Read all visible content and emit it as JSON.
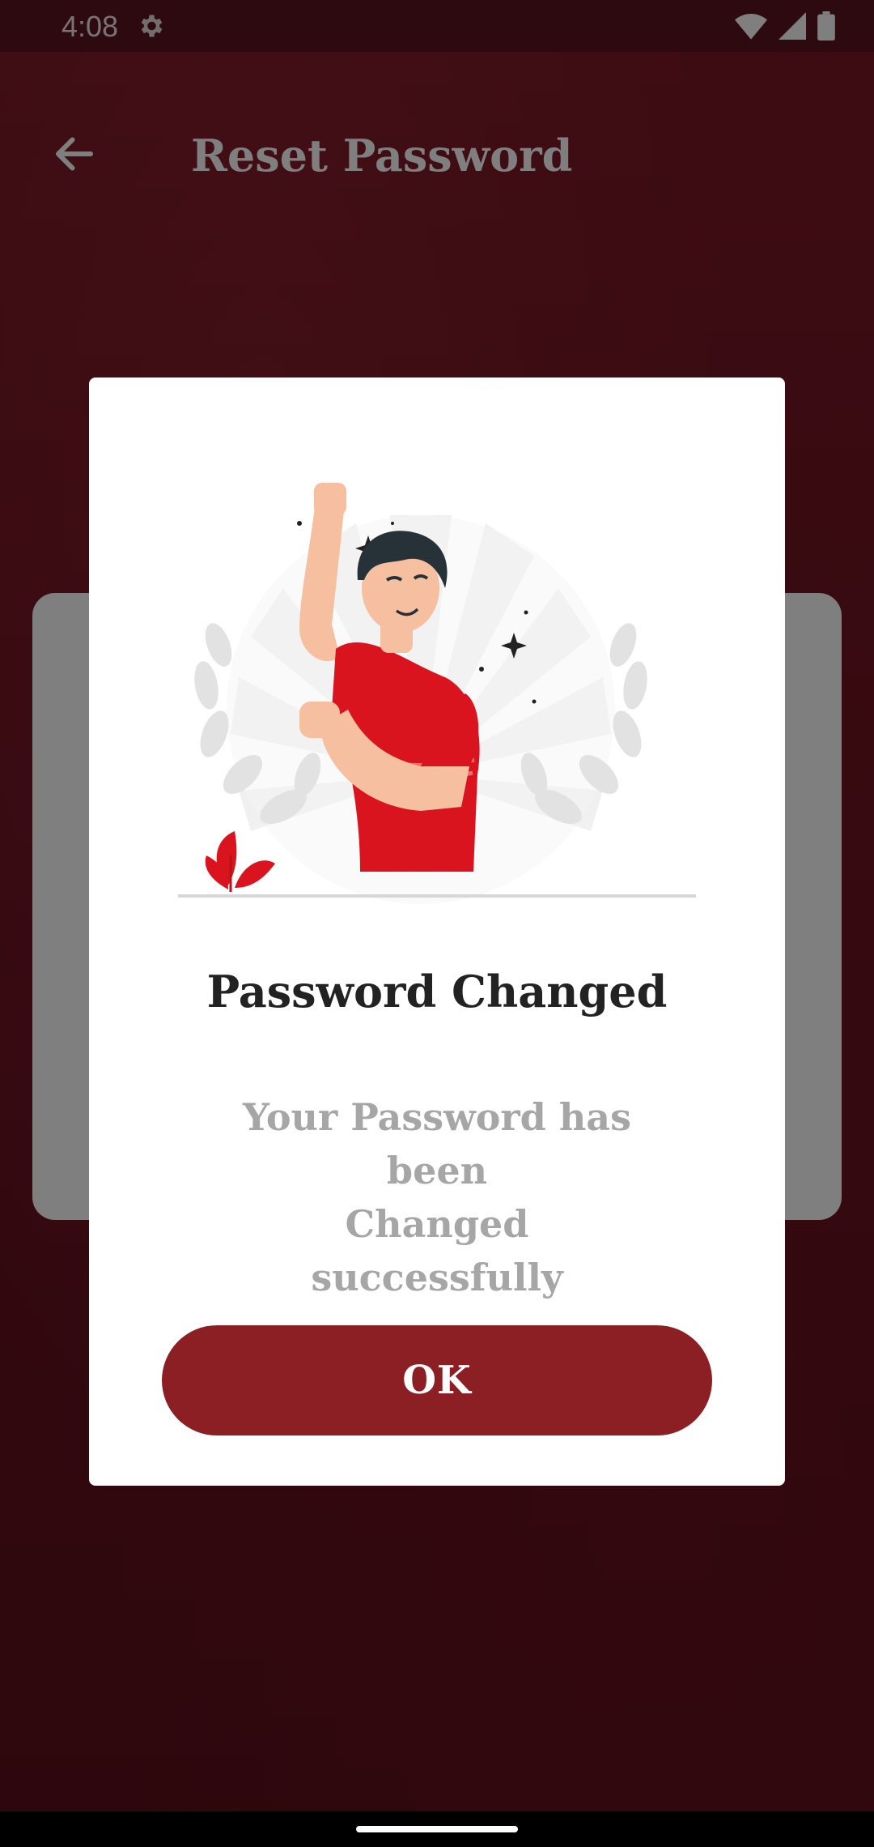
{
  "status_bar": {
    "time": "4:08",
    "icons": [
      "settings-icon",
      "wifi-icon",
      "signal-icon",
      "battery-icon"
    ]
  },
  "screen": {
    "title": "Reset Password",
    "back_icon": "arrow-left-icon"
  },
  "dialog": {
    "illustration_icon": "celebrating-man-illustration",
    "title": "Password Changed",
    "message_line1": "Your Password has been",
    "message_line2": "Changed",
    "message_line3": "successfully",
    "ok_label": "OK"
  },
  "colors": {
    "brand": "#8b1f24",
    "shirt": "#d9141e",
    "background": "#7c1a26"
  }
}
